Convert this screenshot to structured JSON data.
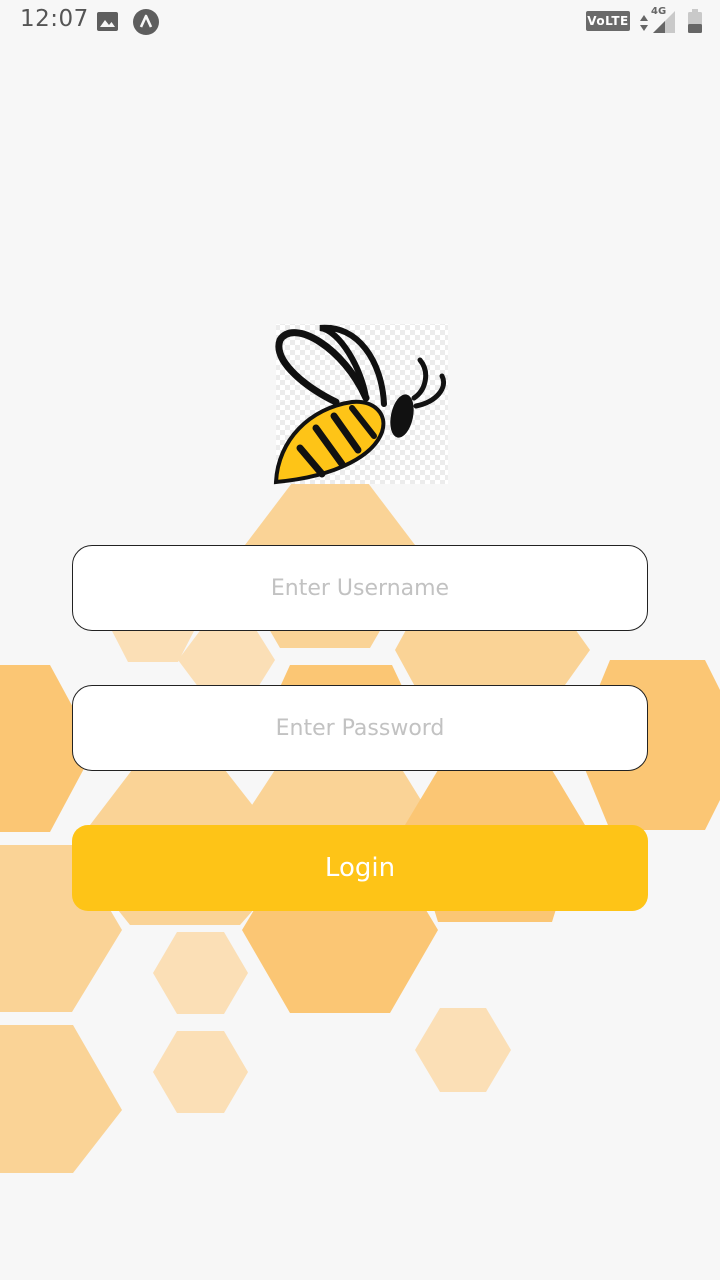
{
  "status_bar": {
    "time": "12:07",
    "volte": "VoLTE",
    "network": "4G",
    "icons": [
      "gallery-icon",
      "app-notification-icon",
      "volte-icon",
      "data-arrows-icon",
      "signal-icon",
      "battery-icon"
    ]
  },
  "login": {
    "username_placeholder": "Enter Username",
    "username_value": "",
    "password_placeholder": "Enter Password",
    "password_value": "",
    "button_label": "Login"
  },
  "colors": {
    "background": "#f7f7f7",
    "button": "#fec417",
    "honeycomb_dark": "#fbc674",
    "honeycomb_mid": "#fad396",
    "honeycomb_light": "#fbdfb6",
    "bee_yellow": "#fec417"
  }
}
